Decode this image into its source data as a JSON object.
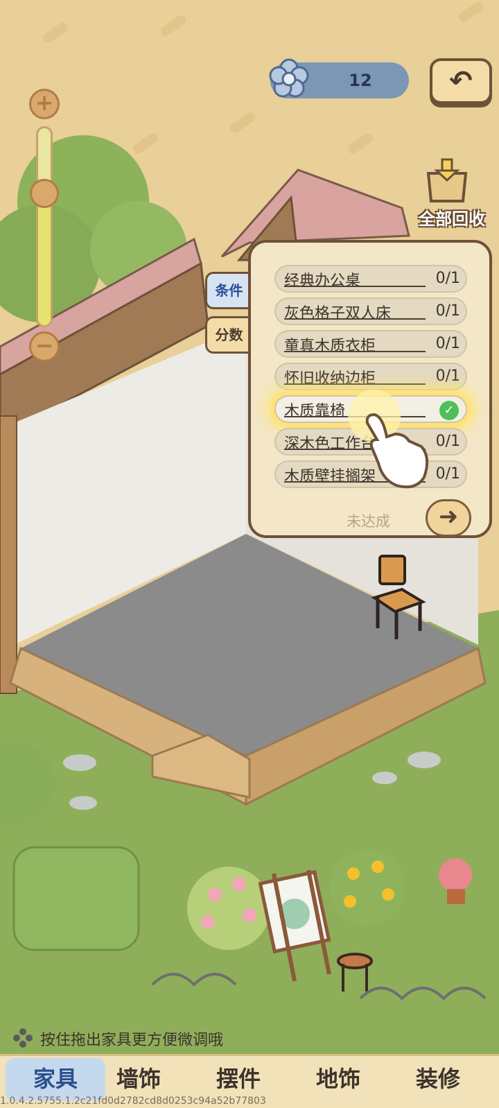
{
  "hud": {
    "flower_count": "12",
    "back_icon": "undo-arrow-icon",
    "recycle_label": "全部回收"
  },
  "zoom": {
    "plus": "+",
    "minus": "−",
    "level": 0.6
  },
  "panel": {
    "tabs": [
      {
        "label": "条件",
        "active": true
      },
      {
        "label": "分数",
        "active": false
      }
    ],
    "items": [
      {
        "name": "经典办公桌",
        "count": "0/1",
        "done": false
      },
      {
        "name": "灰色格子双人床",
        "count": "0/1",
        "done": false
      },
      {
        "name": "童真木质衣柜",
        "count": "0/1",
        "done": false
      },
      {
        "name": "怀旧收纳边柜",
        "count": "0/1",
        "done": false
      },
      {
        "name": "木质靠椅",
        "count": "",
        "done": true
      },
      {
        "name": "深木色工作台",
        "count": "0/1",
        "done": false
      },
      {
        "name": "木质壁挂搁架",
        "count": "0/1",
        "done": false
      }
    ],
    "status": "未达成",
    "next_icon": "arrow-right-icon"
  },
  "hint": "按住拖出家具更方便微调哦",
  "nav": [
    {
      "label": "家具",
      "active": true
    },
    {
      "label": "墙饰",
      "active": false
    },
    {
      "label": "摆件",
      "active": false
    },
    {
      "label": "地饰",
      "active": false
    },
    {
      "label": "装修",
      "active": false
    }
  ],
  "version": "1.0.4.2.5755.1.2c21fd0d2782cd8d0253c94a52b77803",
  "colors": {
    "background": "#e9cf98",
    "grass": "#8fae5a",
    "floor": "#8b8b8b",
    "accent_blue": "#7c96b6",
    "highlight": "#ffe27a"
  }
}
